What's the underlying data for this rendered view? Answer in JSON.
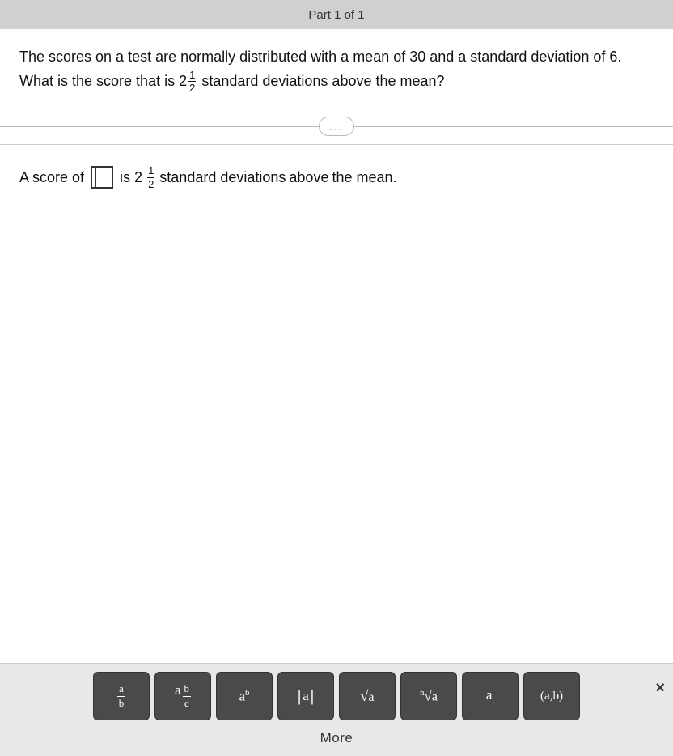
{
  "topBar": {
    "title": "Part 1 of 1"
  },
  "question": {
    "text_part1": "The scores on a test are normally distributed with a mean of 30 and a standard deviation of 6. What is the score that is 2",
    "fraction": {
      "numerator": "1",
      "denominator": "2"
    },
    "text_part2": "standard deviations above the mean?"
  },
  "divider": {
    "dots": "..."
  },
  "answer": {
    "prefix": "A score of",
    "suffix_part1": "is 2",
    "fraction": {
      "numerator": "1",
      "denominator": "2"
    },
    "suffix_part2": "standard deviations",
    "suffix_part3": "above",
    "suffix_part4": "the mean."
  },
  "toolbar": {
    "buttons": [
      {
        "id": "fraction-btn",
        "label": "fraction",
        "aria": "a/b"
      },
      {
        "id": "mixed-btn",
        "label": "mixed number",
        "aria": "a b/c"
      },
      {
        "id": "superscript-btn",
        "label": "superscript",
        "aria": "a^b"
      },
      {
        "id": "abs-btn",
        "label": "absolute value",
        "aria": "|a|"
      },
      {
        "id": "sqrt-btn",
        "label": "square root",
        "aria": "√a"
      },
      {
        "id": "nthroot-btn",
        "label": "nth root",
        "aria": "ⁿ√a"
      },
      {
        "id": "subscript-btn",
        "label": "subscript",
        "aria": "a."
      },
      {
        "id": "paren-btn",
        "label": "parentheses",
        "aria": "(a,b)"
      }
    ],
    "more_label": "More",
    "close_label": "×"
  }
}
